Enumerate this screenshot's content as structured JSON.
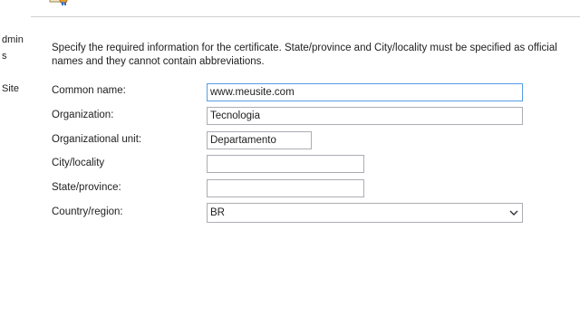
{
  "background_window": {
    "items": [
      "dmin",
      "s",
      "Site"
    ]
  },
  "dialog": {
    "instructions": "Specify the required information for the certificate. State/province and City/locality must be specified as official names and they cannot contain abbreviations.",
    "fields": {
      "common_name": {
        "label": "Common name:",
        "value": "www.meusite.com"
      },
      "organization": {
        "label": "Organization:",
        "value": "Tecnologia"
      },
      "organizational_unit": {
        "label": "Organizational unit:",
        "value": "Departamento"
      },
      "city": {
        "label": "City/locality",
        "value": ""
      },
      "state": {
        "label": "State/province:",
        "value": ""
      },
      "country": {
        "label": "Country/region:",
        "value": "BR"
      }
    }
  },
  "colors": {
    "focus_border": "#569de5",
    "field_border": "#abadb3"
  },
  "icons": {
    "header": "certificate-icon",
    "dropdown": "chevron-down-icon"
  }
}
